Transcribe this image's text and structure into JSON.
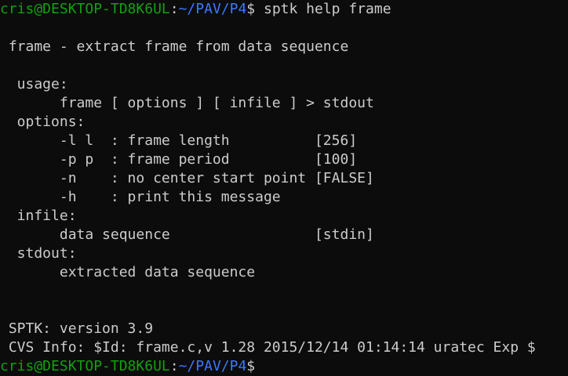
{
  "prompt": {
    "user_host": "cris@DESKTOP-TD8K6UL",
    "colon": ":",
    "path": "~/PAV/P4",
    "sign": "$"
  },
  "command": " sptk help frame",
  "output_lines": [
    "",
    " frame - extract frame from data sequence",
    "",
    "  usage:",
    "       frame [ options ] [ infile ] > stdout",
    "  options:",
    "       -l l  : frame length          [256]",
    "       -p p  : frame period          [100]",
    "       -n    : no center start point [FALSE]",
    "       -h    : print this message",
    "  infile:",
    "       data sequence                 [stdin]",
    "  stdout:",
    "       extracted data sequence",
    "",
    "",
    " SPTK: version 3.9",
    " CVS Info: $Id: frame.c,v 1.28 2015/12/14 01:14:14 uratec Exp $"
  ],
  "colors": {
    "background": "#0c0c0c",
    "text": "#cccccc",
    "user_host": "#13a10e",
    "path": "#3b78ff"
  }
}
